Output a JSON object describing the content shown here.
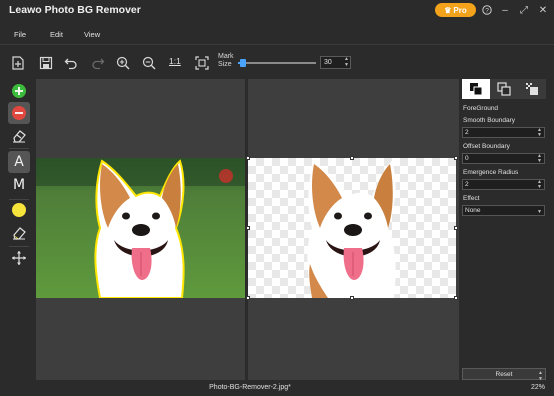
{
  "app": {
    "title": "Leawo Photo BG Remover",
    "pro_label": "Pro"
  },
  "window_controls": {
    "help": "?",
    "minimize": "–",
    "restore": "⤢",
    "close": "✕"
  },
  "menu": {
    "items": [
      "File",
      "Edit",
      "View"
    ]
  },
  "toolbar": {
    "one_to_one": "1:1",
    "mark_size_label": "Mark Size",
    "mark_size_value": "30",
    "mark_size_fraction": 0.06
  },
  "left_tools": {
    "text_tool": "A",
    "manual_tool": "M"
  },
  "right_panel": {
    "section_title": "ForeGround",
    "smooth_boundary_label": "Smooth Boundary",
    "smooth_boundary_value": "2",
    "offset_boundary_label": "Offset Boundary",
    "offset_boundary_value": "0",
    "emergence_radius_label": "Emergence Radius",
    "emergence_radius_value": "2",
    "effect_label": "Effect",
    "effect_value": "None",
    "reset_label": "Reset"
  },
  "status": {
    "filename": "Photo-BG-Remover-2.jpg*",
    "zoom": "22%"
  },
  "colors": {
    "accent": "#4aa3ff",
    "pro": "#f2a21b",
    "add_green": "#3dbb3d",
    "remove_red": "#e0483f",
    "mark_yellow": "#f6e33b",
    "outline": "#ffe600"
  }
}
